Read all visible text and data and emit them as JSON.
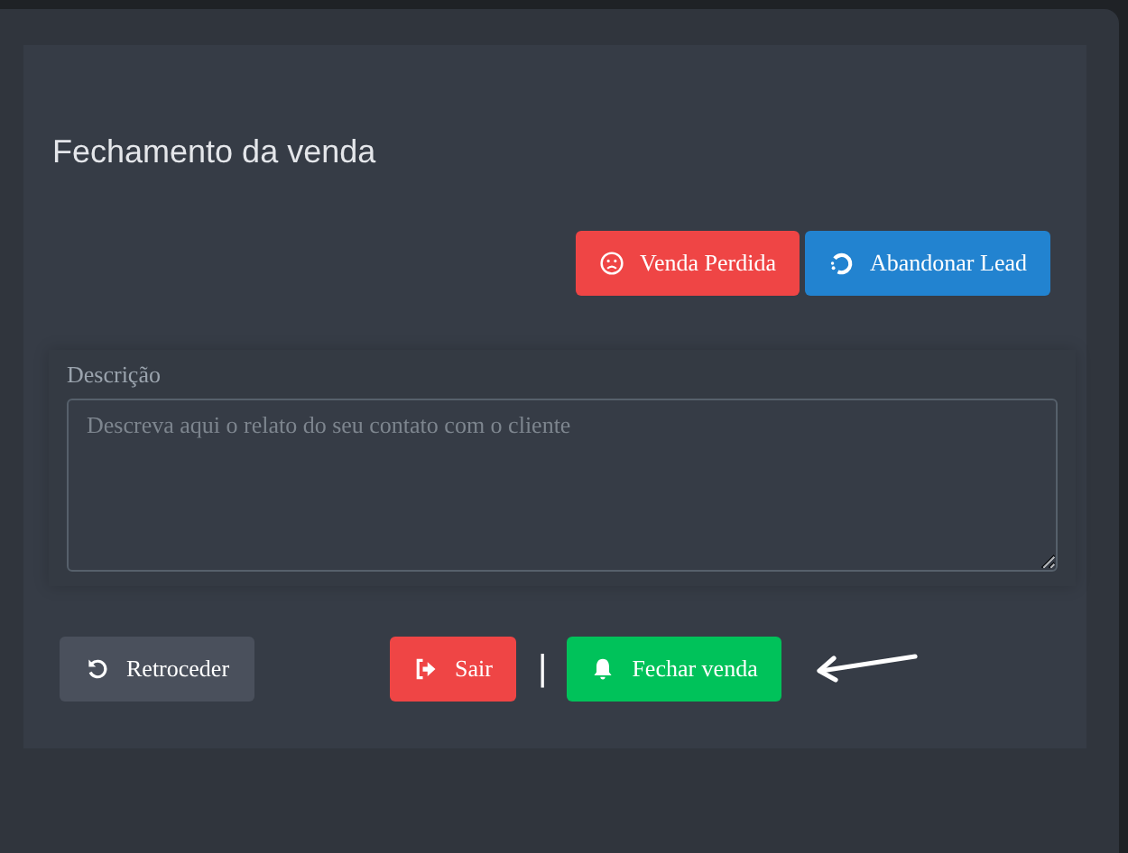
{
  "title": "Fechamento da venda",
  "top_actions": [
    {
      "label": "Venda Perdida",
      "kind": "lost"
    },
    {
      "label": "Abandonar Lead",
      "kind": "abandon"
    }
  ],
  "description": {
    "label": "Descrição",
    "placeholder": "Descreva aqui o relato do seu contato com o cliente"
  },
  "back_button": {
    "label": "Retroceder"
  },
  "exit_button": {
    "label": "Sair"
  },
  "separator": "|",
  "close_button": {
    "label": "Fechar venda"
  }
}
